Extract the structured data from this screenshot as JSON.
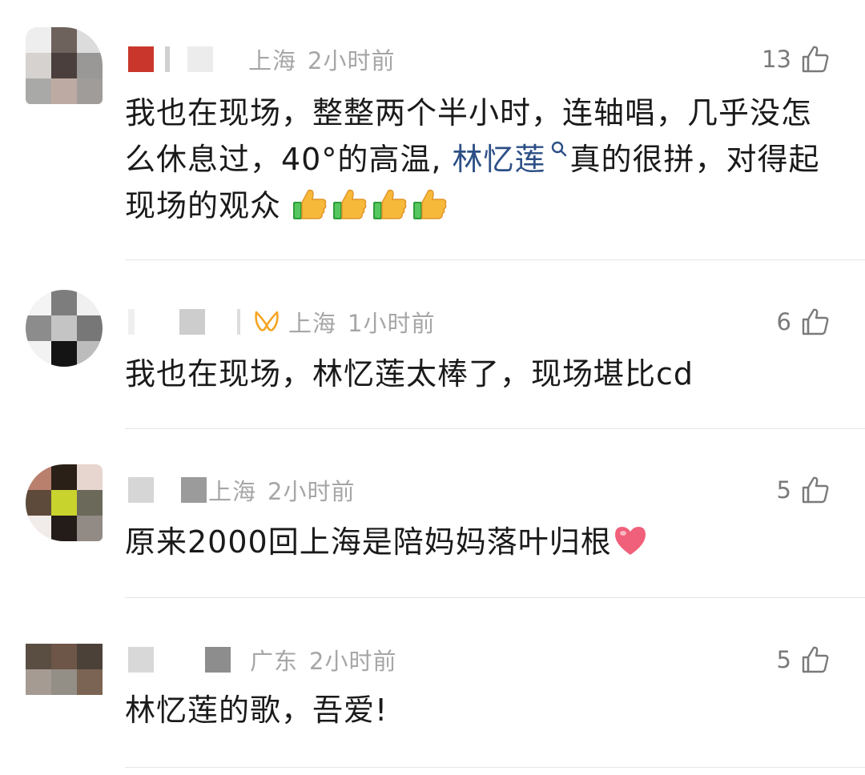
{
  "colors": {
    "meta_gray": "#a6a6a6",
    "like_gray": "#7a7a7a",
    "mention_blue": "#2c4f86",
    "divider": "#e6e6e6",
    "vip_orange": "#f5a623"
  },
  "comments": [
    {
      "location": "上海",
      "time": "2小时前",
      "likes": "13",
      "text_parts": [
        "我也在现场，整整两个半小时，连轴唱，几乎没怎么休息过，40°的高温, ",
        "林忆莲",
        "真的很拼，对得起现场的观众"
      ],
      "emoji": [
        "thumbs-up",
        "thumbs-up",
        "thumbs-up",
        "thumbs-up"
      ]
    },
    {
      "location": "上海",
      "time": "1小时前",
      "likes": "6",
      "text": "我也在现场，林忆莲太棒了，现场堪比cd"
    },
    {
      "location": "上海",
      "time": "2小时前",
      "likes": "5",
      "text": "原来2000回上海是陪妈妈落叶归根",
      "emoji": [
        "red-heart"
      ]
    },
    {
      "location": "广东",
      "time": "2小时前",
      "likes": "5",
      "text": "林忆莲的歌，吾爱!"
    }
  ]
}
